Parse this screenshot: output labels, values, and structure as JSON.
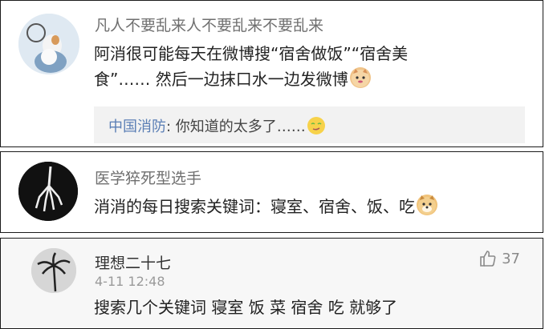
{
  "comments": [
    {
      "username": "凡人不要乱来人不要乱来不要乱来",
      "text_line1": "阿消很可能每天在微博搜“宿舍做饭”“宿舍美",
      "text_line2": "食”…… 然后一边抹口水一边发微博",
      "emoji": "cat-emoji",
      "reply": {
        "user": "中国消防",
        "text": ": 你知道的太多了……",
        "emoji": "smirk-emoji"
      }
    },
    {
      "username": "医学猝死型选手",
      "text": "消消的每日搜索关键词：寝室、宿舍、饭、吃",
      "emoji": "doge-emoji"
    },
    {
      "username": "理想二十七",
      "timestamp": "4-11 12:48",
      "like_count": "37",
      "text": "搜索几个关键词  寝室  饭  菜  宿舍  吃 就够了"
    }
  ],
  "colors": {
    "link": "#5b7fb5",
    "name": "#6f6f6f",
    "reply_bg": "#f2f2f2"
  }
}
